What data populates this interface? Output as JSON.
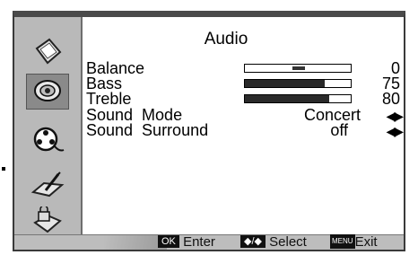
{
  "menu": {
    "title": "Audio",
    "items": [
      {
        "label": "Balance",
        "value": "0",
        "level": 0.5
      },
      {
        "label": "Bass",
        "value": "75",
        "level": 0.75
      },
      {
        "label": "Treble",
        "value": "80",
        "level": 0.8
      },
      {
        "label": "Sound  Mode",
        "value": "Concert"
      },
      {
        "label": "Sound  Surround",
        "value": "off"
      }
    ]
  },
  "sidebar": {
    "icons": [
      "picture-icon",
      "audio-icon",
      "reel-icon",
      "setup-icon",
      "lock-icon"
    ],
    "selected": "audio-icon"
  },
  "footer": {
    "ok_key": "OK",
    "enter_label": "Enter",
    "nav_key": "◆/◆",
    "select_label": "Select",
    "menu_key": "MENU",
    "exit_label": "Exit"
  }
}
